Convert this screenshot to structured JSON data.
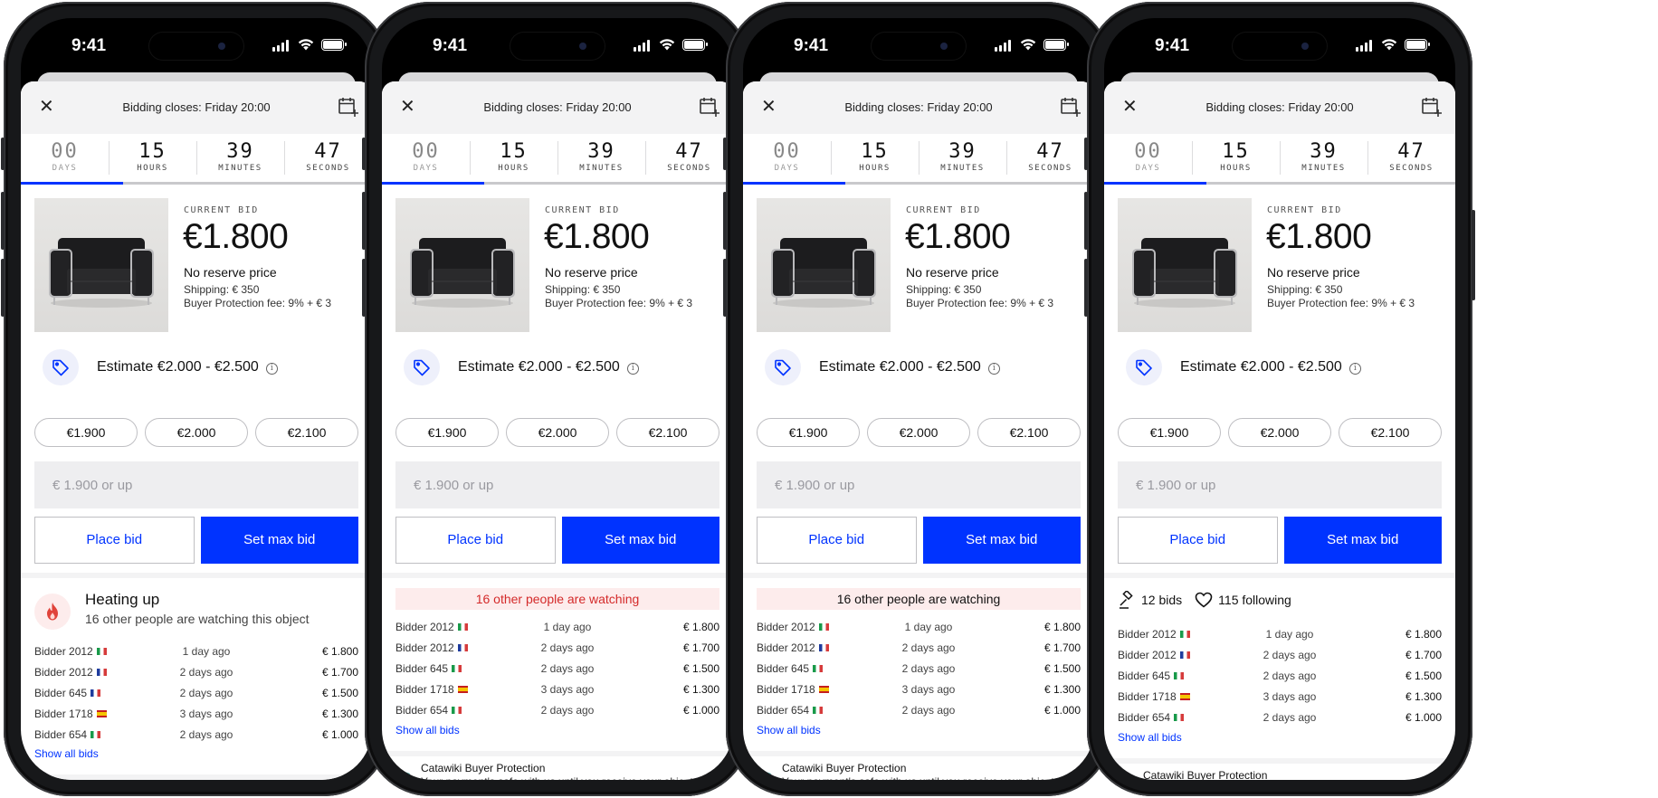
{
  "status_bar": {
    "time": "9:41"
  },
  "sheet": {
    "title": "Bidding closes: Friday 20:00"
  },
  "countdown": [
    {
      "value": "00",
      "label": "DAYS"
    },
    {
      "value": "15",
      "label": "HOURS"
    },
    {
      "value": "39",
      "label": "MINUTES"
    },
    {
      "value": "47",
      "label": "SECONDS"
    }
  ],
  "countdown_progress_fraction": 0.29,
  "product": {
    "current_bid_label": "CURRENT BID",
    "price": "€1.800",
    "reserve": "No reserve price",
    "shipping": "Shipping: € 350",
    "fee": "Buyer Protection fee: 9% + € 3"
  },
  "estimate": {
    "text": "Estimate €2.000 - €2.500",
    "info_glyph": "i"
  },
  "quick_bids": [
    "€1.900",
    "€2.000",
    "€2.100"
  ],
  "bid_input": {
    "placeholder": "€ 1.900 or up",
    "value": ""
  },
  "actions": {
    "place": "Place bid",
    "max": "Set max bid"
  },
  "bid_rows_v1": [
    {
      "bidder": "Bidder 2012",
      "flag": "it",
      "when": "1 day ago",
      "amount": "€ 1.800"
    },
    {
      "bidder": "Bidder 2012",
      "flag": "fr",
      "when": "2 days ago",
      "amount": "€ 1.700"
    },
    {
      "bidder": "Bidder 645",
      "flag": "fr",
      "when": "2 days ago",
      "amount": "€ 1.500"
    },
    {
      "bidder": "Bidder 1718",
      "flag": "es",
      "when": "3 days ago",
      "amount": "€ 1.300"
    },
    {
      "bidder": "Bidder 654",
      "flag": "it",
      "when": "2 days ago",
      "amount": "€ 1.000"
    }
  ],
  "bid_rows_v2": [
    {
      "bidder": "Bidder 2012",
      "flag": "it",
      "when": "1 day ago",
      "amount": "€ 1.800"
    },
    {
      "bidder": "Bidder 2012",
      "flag": "fr",
      "when": "2 days ago",
      "amount": "€ 1.700"
    },
    {
      "bidder": "Bidder 645",
      "flag": "it",
      "when": "2 days ago",
      "amount": "€ 1.500"
    },
    {
      "bidder": "Bidder 1718",
      "flag": "es",
      "when": "3 days ago",
      "amount": "€ 1.300"
    },
    {
      "bidder": "Bidder 654",
      "flag": "it",
      "when": "2 days ago",
      "amount": "€ 1.000"
    }
  ],
  "show_all": "Show all bids",
  "heating": {
    "title": "Heating up",
    "subtitle": "16 other people are watching this object"
  },
  "watching": "16 other people are watching",
  "stats": {
    "bids": "12 bids",
    "following": "115 following"
  },
  "protection": {
    "title": "Catawiki Buyer Protection",
    "subtitle": "Your payment's safe with us until you receive your object"
  },
  "colors": {
    "accent": "#0033ff",
    "alert_text": "#d42a2a",
    "alert_bg": "#fdecec",
    "phone_frame": "#17181a"
  },
  "icons": [
    "close-icon",
    "calendar-add-icon",
    "tag-icon",
    "info-icon",
    "flame-icon",
    "gavel-icon",
    "heart-icon",
    "shield-icon"
  ]
}
